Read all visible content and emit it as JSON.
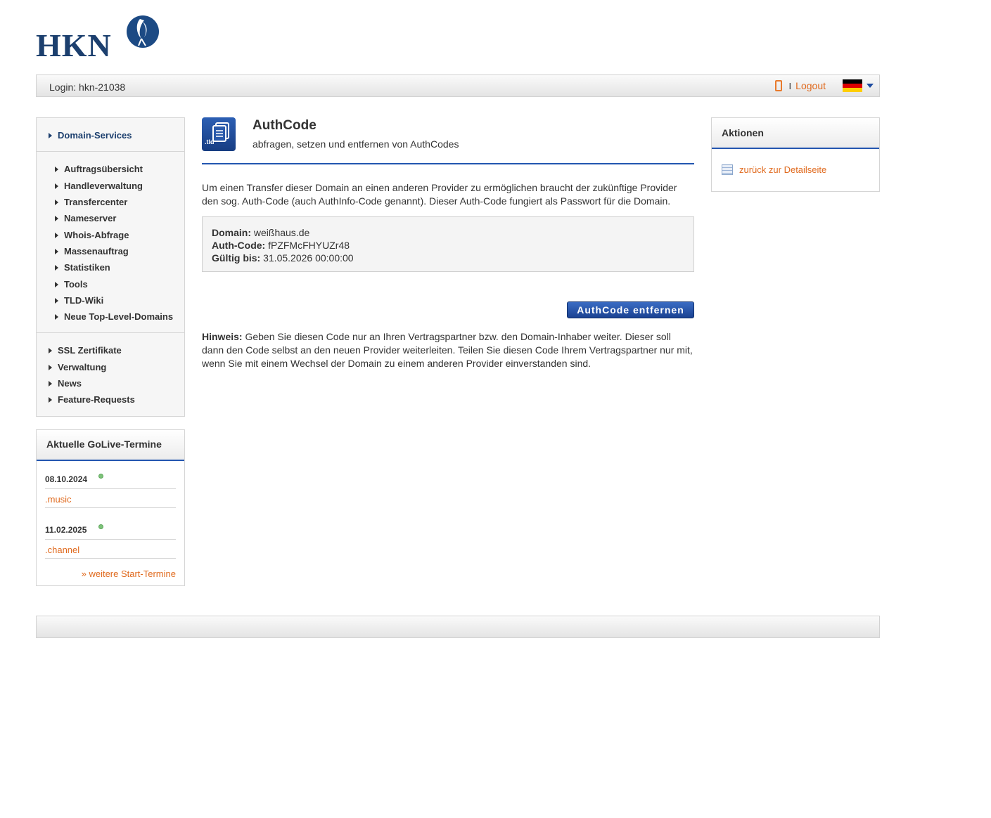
{
  "brand": {
    "logo_text": "HKN"
  },
  "topbar": {
    "login": "Login: hkn-21038",
    "separator": "I",
    "logout": "Logout",
    "flag_colors": [
      "#000000",
      "#dd0000",
      "#ffce00"
    ]
  },
  "sidebar": {
    "head": "Domain-Services",
    "sub_items": [
      "Auftragsübersicht",
      "Handleverwaltung",
      "Transfercenter",
      "Nameserver",
      "Whois-Abfrage",
      "Massenauftrag",
      "Statistiken",
      "Tools",
      "TLD-Wiki",
      "Neue Top-Level-Domains"
    ],
    "items": [
      "SSL Zertifikate",
      "Verwaltung",
      "News",
      "Feature-Requests"
    ]
  },
  "golive": {
    "title": "Aktuelle GoLive-Termine",
    "entries": [
      {
        "date": "08.10.2024",
        "tld": ".music"
      },
      {
        "date": "11.02.2025",
        "tld": ".channel"
      }
    ],
    "more": "» weitere Start-Termine"
  },
  "main": {
    "icon_label": ".tld",
    "title": "AuthCode",
    "subtitle": "abfragen, setzen und entfernen von AuthCodes",
    "intro": "Um einen Transfer dieser Domain an einen anderen Provider zu ermöglichen braucht der zukünftige Provider den sog. Auth-Code (auch AuthInfo-Code genannt). Dieser Auth-Code fungiert als Passwort für die Domain.",
    "info": {
      "domain_label": "Domain:",
      "domain_value": "weißhaus.de",
      "auth_label": "Auth-Code:",
      "auth_value": "fPZFMcFHYUZr48",
      "valid_label": "Gültig bis:",
      "valid_value": "31.05.2026 00:00:00"
    },
    "remove_button": "AuthCode entfernen",
    "hint_label": "Hinweis:",
    "hint_text": "Geben Sie diesen Code nur an Ihren Vertragspartner bzw. den Domain-Inhaber weiter. Dieser soll dann den Code selbst an den neuen Provider weiterleiten. Teilen Sie diesen Code Ihrem Vertragspartner nur mit, wenn Sie mit einem Wechsel der Domain zu einem anderen Provider einverstanden sind."
  },
  "actions": {
    "title": "Aktionen",
    "back_link": "zurück zur Detailseite"
  },
  "colors": {
    "accent_blue": "#2356b0",
    "link_orange": "#e06a1e",
    "brand_navy": "#1c3f6e",
    "status_green": "#7dc37a"
  }
}
